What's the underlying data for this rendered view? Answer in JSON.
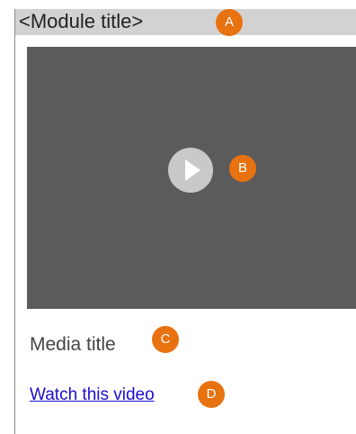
{
  "module": {
    "title": "<Module title>"
  },
  "video": {
    "play_icon": "play-icon"
  },
  "media": {
    "title": "Media title",
    "link_label": "Watch this video"
  },
  "badges": {
    "a": "A",
    "b": "B",
    "c": "C",
    "d": "D",
    "color": "#e87110"
  },
  "colors": {
    "header_bg": "#d2d2d2",
    "video_bg": "#5b5b5c",
    "play_button": "#c9c9c9",
    "link": "#1a0dcc"
  }
}
